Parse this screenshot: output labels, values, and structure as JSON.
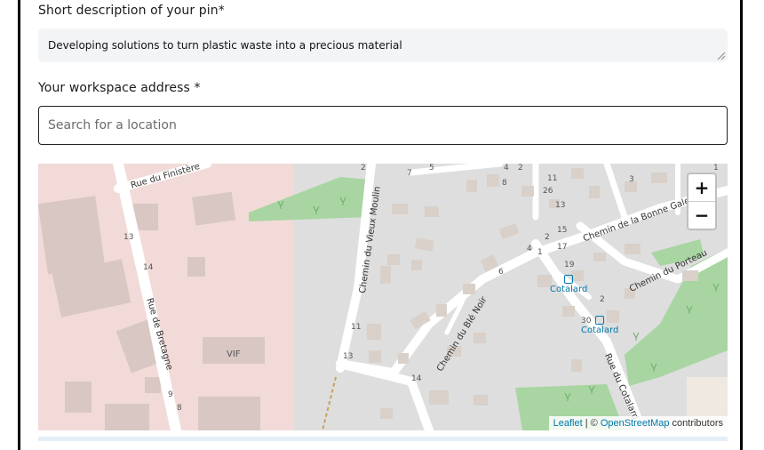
{
  "form": {
    "desc_label": "Short description of your pin*",
    "desc_value": "Developing solutions to turn plastic waste into a precious material",
    "address_label": "Your workspace address *",
    "search_placeholder": "Search for a location"
  },
  "map": {
    "zoom_in": "+",
    "zoom_out": "−",
    "attribution": {
      "leaflet": "Leaflet",
      "sep": " | © ",
      "osm": "OpenStreetMap",
      "suffix": " contributors"
    },
    "streets": {
      "finistere": "Rue du Finistère",
      "bretagne": "Rue de Bretagne",
      "vieux_moulin": "Chemin du Vieux Moulin",
      "ble_noir": "Chemin du Blé Noir",
      "bonne_galette": "Chemin de la Bonne Galette",
      "porteau": "Chemin du Porteau",
      "cotalard_rue": "Rue du Cotalard"
    },
    "places": {
      "vif": "VIF",
      "bus1": "Cotalard",
      "bus2": "Cotalard"
    },
    "house_numbers": [
      "2",
      "7",
      "5",
      "13",
      "14",
      "9",
      "8",
      "11",
      "13",
      "14",
      "4",
      "2",
      "8",
      "11",
      "26",
      "13",
      "15",
      "2",
      "17",
      "4",
      "1",
      "19",
      "6",
      "3",
      "2",
      "30",
      "1"
    ]
  },
  "colors": {
    "industrial": "#f2dad8",
    "park": "#a8d5a2",
    "road": "#ffffff",
    "building": "#d9d0c9",
    "link": "#0078a8"
  }
}
